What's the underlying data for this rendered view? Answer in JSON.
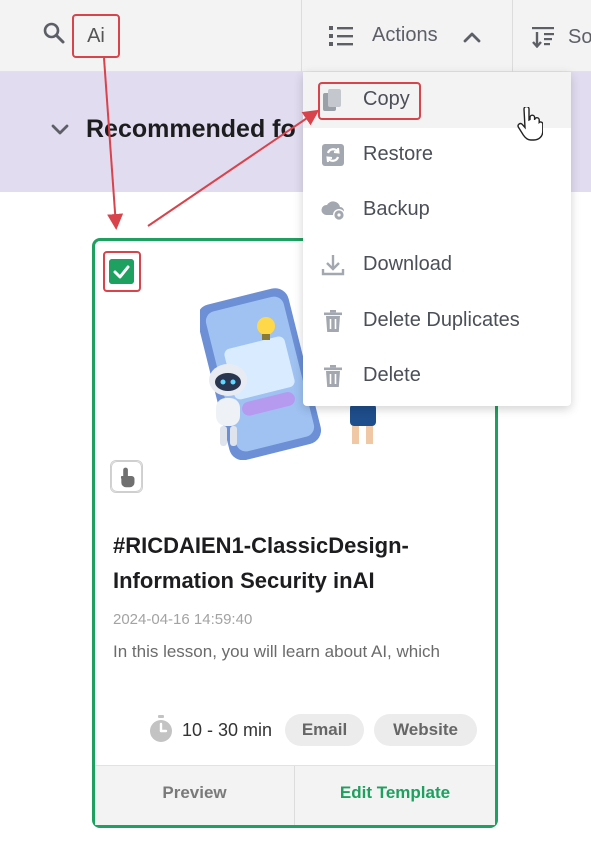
{
  "toolbar": {
    "search_value": "Ai",
    "actions_label": "Actions",
    "sort_label": "So"
  },
  "section": {
    "title": "Recommended fo"
  },
  "menu": {
    "items": [
      {
        "label": "Copy",
        "icon": "copy-icon"
      },
      {
        "label": "Restore",
        "icon": "restore-icon"
      },
      {
        "label": "Backup",
        "icon": "cloud-backup-icon"
      },
      {
        "label": "Download",
        "icon": "download-icon"
      },
      {
        "label": "Delete Duplicates",
        "icon": "trash-icon"
      },
      {
        "label": "Delete",
        "icon": "trash-icon"
      }
    ]
  },
  "card": {
    "title": "#RICDAIEN1-ClassicDesign-Information Security inAI",
    "date": "2024-04-16 14:59:40",
    "description": "In this lesson, you will learn about AI, which",
    "duration": "10 - 30 min",
    "tags": [
      "Email",
      "Website"
    ],
    "preview_label": "Preview",
    "edit_label": "Edit Template",
    "selected": true
  },
  "colors": {
    "accent_green": "#1ea060",
    "highlight_red": "#d9434b",
    "banner_purple": "#e2dcf0"
  }
}
